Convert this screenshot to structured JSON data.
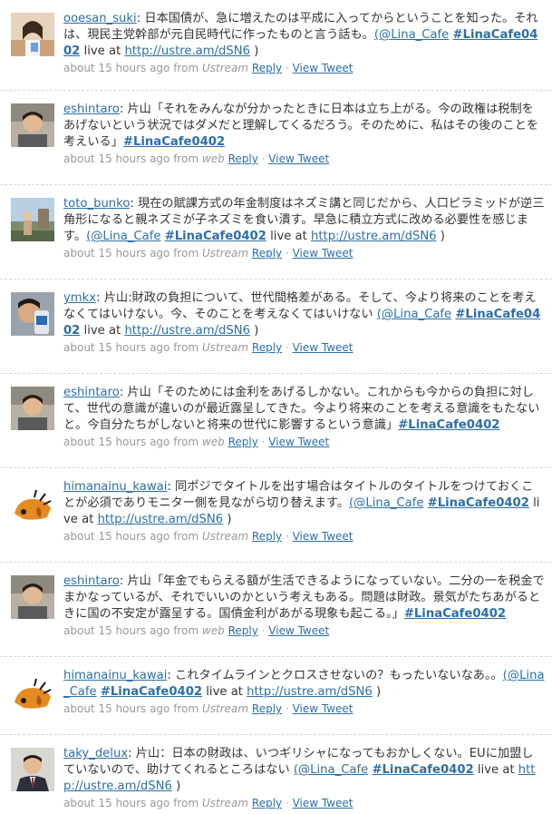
{
  "tweets": [
    {
      "avatar": "avatar-woman-photo",
      "user": "ooesan_suki",
      "text": ": 日本国債が、急に増えたのは平成に入ってからということを知った。それは、現民主党幹部が元自民時代に作ったものと言う話も。",
      "mention": "(@Lina_Cafe",
      "hashtag": "#LinaCafe0402",
      "live": " live at ",
      "url": "http://ustre.am/dSN6",
      "close": " )",
      "time": "about 15 hours ago",
      "from": " from ",
      "source": "Ustream",
      "reply": "Reply",
      "view": "View Tweet",
      "height": 100
    },
    {
      "avatar": "avatar-man-photo",
      "user": "eshintaro",
      "text": ": 片山「それをみんなが分かったときに日本は立ち上がる。今の政権は税制をあげないという状況ではダメだと理解してくるだろう。そのために、私はその後のことを考えいる」",
      "mention": "",
      "hashtag": "#LinaCafe0402",
      "live": "",
      "url": "",
      "close": "",
      "time": "about 15 hours ago",
      "from": " from ",
      "source": "web",
      "reply": "Reply",
      "view": "View Tweet",
      "height": 104
    },
    {
      "avatar": "avatar-landscape-photo",
      "user": "toto_bunko",
      "text": ": 現在の賦課方式の年金制度はネズミ講と同じだから、人口ピラミッドが逆三角形になると親ネズミが子ネズミを食い潰す。早急に積立方式に改める必要性を感じます。",
      "mention": "(@Lina_Cafe",
      "hashtag": "#LinaCafe0402",
      "live": " live at ",
      "url": "http://ustre.am/dSN6",
      "close": " )",
      "time": "about 15 hours ago",
      "from": " from ",
      "source": "Ustream",
      "reply": "Reply",
      "view": "View Tweet",
      "height": 104
    },
    {
      "avatar": "avatar-drinking-photo",
      "user": "ymkx",
      "text": ": 片山:財政の負担について、世代間格差がある。そして、今より将来のことを考えなくてはいけない。今、そのことを考えなくてはいけない ",
      "mention": "(@Lina_Cafe",
      "hashtag": "#LinaCafe0402",
      "live": " live at ",
      "url": "http://ustre.am/dSN6",
      "close": " )",
      "time": "about 15 hours ago",
      "from": " from ",
      "source": "Ustream",
      "reply": "Reply",
      "view": "View Tweet",
      "height": 104
    },
    {
      "avatar": "avatar-man-photo",
      "user": "eshintaro",
      "text": ": 片山「そのためには金利をあげるしかない。これからも今からの負担に対して、世代の意識が違いのが最近露呈してきた。今より将来のことを考える意識をもたないと。今自分たちがしないと将来の世代に影響するという意識」",
      "mention": "",
      "hashtag": "#LinaCafe0402",
      "live": "",
      "url": "",
      "close": "",
      "time": "about 15 hours ago",
      "from": " from ",
      "source": "web",
      "reply": "Reply",
      "view": "View Tweet",
      "height": 104
    },
    {
      "avatar": "avatar-dog-cartoon",
      "user": "himanainu_kawai",
      "text": ": 同ポジでタイトルを出す場合はタイトルのタイトルをつけておくことが必須でありモニター側を見ながら切り替えます。",
      "mention": "(@Lina_Cafe",
      "hashtag": "#LinaCafe0402",
      "live": " live at ",
      "url": "http://ustre.am/dSN6",
      "close": " )",
      "time": "about 15 hours ago",
      "from": " from ",
      "source": "Ustream",
      "reply": "Reply",
      "view": "View Tweet",
      "height": 104
    },
    {
      "avatar": "avatar-man-photo",
      "user": "eshintaro",
      "text": ": 片山「年金でもらえる額が生活できるようになっていない。二分の一を税金でまかなっているが、それでいいのかという考えもある。問題は財政。景気がたちあがるときに国の不安定が露呈する。国債金利があがる現象も起こる。」",
      "mention": "",
      "hashtag": "#LinaCafe0402",
      "live": "",
      "url": "",
      "close": "",
      "time": "about 15 hours ago",
      "from": " from ",
      "source": "web",
      "reply": "Reply",
      "view": "View Tweet",
      "height": 104
    },
    {
      "avatar": "avatar-dog-cartoon",
      "user": "himanainu_kawai",
      "text": ": これタイムラインとクロスさせないの？もったいないなあ。。",
      "mention": "(@Lina_Cafe",
      "hashtag": "#LinaCafe0402",
      "live": " live at ",
      "url": "http://ustre.am/dSN6",
      "close": " )",
      "time": "about 15 hours ago",
      "from": " from ",
      "source": "Ustream",
      "reply": "Reply",
      "view": "View Tweet",
      "height": 86
    },
    {
      "avatar": "avatar-suit-man-photo",
      "user": "taky_delux",
      "text": ": 片山：日本の財政は、いつギリシャになってもおかしくない。EUに加盟していないので、助けてくれるところはない ",
      "mention": "(@Lina_Cafe",
      "hashtag": "#LinaCafe0402",
      "live": " live at ",
      "url": "http://ustre.am/dSN6",
      "close": " )",
      "time": "about 15 hours ago",
      "from": " from ",
      "source": "Ustream",
      "reply": "Reply",
      "view": "View Tweet",
      "height": 91
    }
  ]
}
